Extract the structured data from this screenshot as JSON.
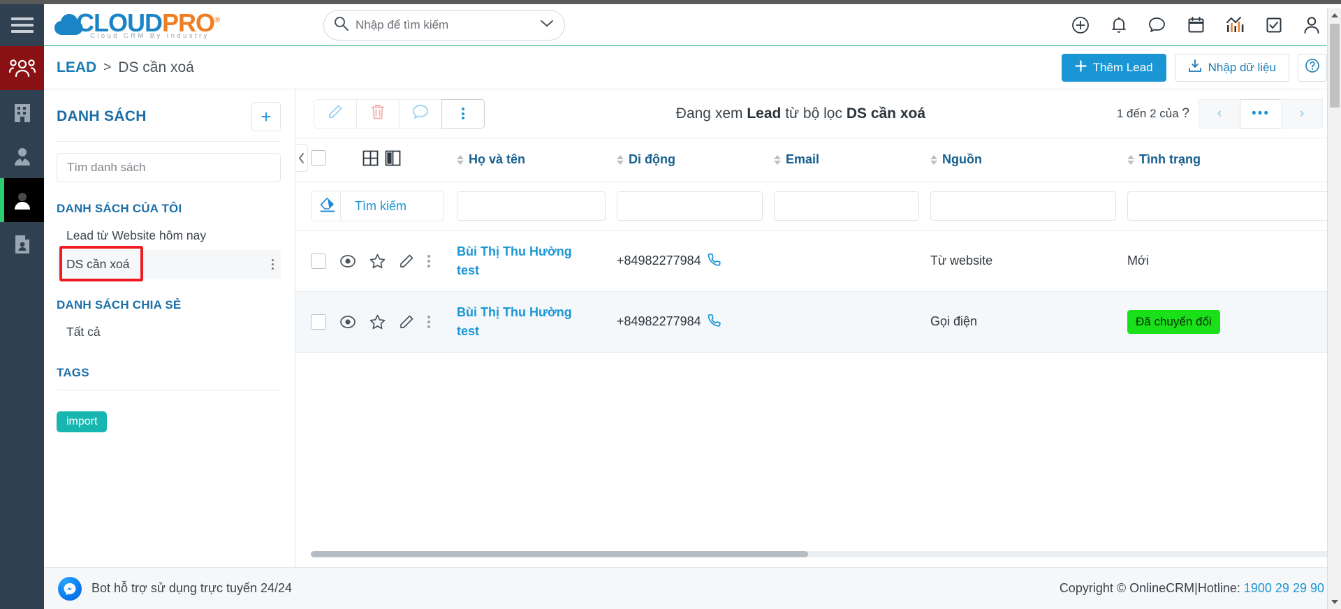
{
  "app": {
    "logo_primary": "CLOUD",
    "logo_secondary": "PRO",
    "logo_reg": "®",
    "logo_tagline": "Cloud CRM By Industry"
  },
  "colors": {
    "brand_blue": "#1b96d5",
    "brand_orange": "#f07d22",
    "rail_dark": "#2f4050",
    "lead_red": "#8a1113",
    "accent_green": "#2ecc71",
    "tag_teal": "#18b6b0",
    "badge_green": "#19e019",
    "highlight_red": "#ee1c22"
  },
  "search": {
    "placeholder": "Nhập để tìm kiếm",
    "value": ""
  },
  "header_icons": [
    {
      "name": "add-circle-icon",
      "label": "Thêm mới"
    },
    {
      "name": "bell-icon",
      "label": "Thông báo"
    },
    {
      "name": "chat-icon",
      "label": "Tin nhắn"
    },
    {
      "name": "calendar-icon",
      "label": "Lịch"
    },
    {
      "name": "chart-icon",
      "label": "Báo cáo"
    },
    {
      "name": "task-check-icon",
      "label": "Công việc"
    },
    {
      "name": "user-icon",
      "label": "Tài khoản"
    }
  ],
  "rail": [
    {
      "name": "menu-burger-icon",
      "label": "Menu"
    },
    {
      "name": "group-people-icon",
      "label": "Lead"
    },
    {
      "name": "building-icon",
      "label": "Công ty"
    },
    {
      "name": "contact-person-icon",
      "label": "Liên hệ"
    },
    {
      "name": "person-active-icon",
      "label": "Khách hàng"
    },
    {
      "name": "document-person-icon",
      "label": "Hồ sơ"
    }
  ],
  "breadcrumb": {
    "root": "LEAD",
    "separator": ">",
    "current": "DS cần xoá"
  },
  "crumb_actions": {
    "add_lead": "Thêm Lead",
    "import_data": "Nhập dữ liệu",
    "help": "?"
  },
  "list_panel": {
    "title": "DANH SÁCH",
    "add_label": "+",
    "search_placeholder": "Tìm danh sách",
    "search_value": "",
    "my_lists_label": "DANH SÁCH CỦA TÔI",
    "my_lists": [
      {
        "label": "Lead từ Website hôm nay",
        "selected": false
      },
      {
        "label": "DS cần xoá",
        "selected": true
      }
    ],
    "shared_lists_label": "DANH SÁCH CHIA SẺ",
    "shared_lists": [
      {
        "label": "Tất cả",
        "selected": false
      }
    ],
    "tags_label": "TAGS",
    "tags": [
      {
        "label": "import"
      }
    ]
  },
  "toolbar": {
    "edit_label": "Sửa",
    "delete_label": "Xoá",
    "comment_label": "Bình luận",
    "more_label": "Thêm"
  },
  "view_title": {
    "prefix": "Đang xem",
    "module": "Lead",
    "middle": "từ bộ lọc",
    "filter": "DS cần xoá"
  },
  "pagination": {
    "range_text": "1 đến 2 của",
    "total": "?",
    "prev": "‹",
    "more": "•••",
    "next": "›"
  },
  "filter_row": {
    "erase_label": "Xoá bộ lọc",
    "search_label": "Tìm kiếm",
    "inputs": [
      "",
      "",
      "",
      "",
      ""
    ]
  },
  "table": {
    "columns": [
      {
        "key": "name",
        "label": "Họ và tên",
        "sortable": true
      },
      {
        "key": "mobile",
        "label": "Di động",
        "sortable": true
      },
      {
        "key": "email",
        "label": "Email",
        "sortable": true
      },
      {
        "key": "source",
        "label": "Nguồn",
        "sortable": true
      },
      {
        "key": "status",
        "label": "Tình trạng",
        "sortable": true
      }
    ],
    "rows": [
      {
        "name": "Bùi Thị Thu Hường test",
        "mobile": "+84982277984",
        "email": "",
        "source": "Từ website",
        "status": "Mới",
        "status_badge": false
      },
      {
        "name": "Bùi Thị Thu Hường test",
        "mobile": "+84982277984",
        "email": "",
        "source": "Gọi điện",
        "status": "Đã chuyển đổi",
        "status_badge": true
      }
    ]
  },
  "footer": {
    "bot_text": "Bot hỗ trợ sử dụng trực tuyến 24/24",
    "copyright": "Copyright © OnlineCRM",
    "divider": "|",
    "hotline_label": "Hotline:",
    "hotline_number": "1900 29 29 90"
  }
}
